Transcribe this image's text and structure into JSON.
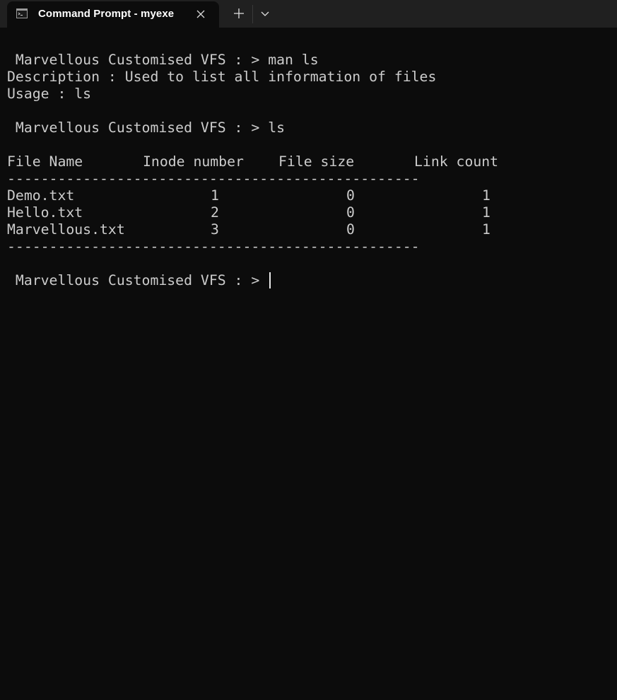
{
  "window": {
    "tab_title": "Command Prompt - myexe",
    "icons": {
      "tab_icon": "console-app-icon",
      "close": "close-icon",
      "new_tab": "plus-icon",
      "dropdown": "chevron-down-icon"
    }
  },
  "console": {
    "prompt1": " Marvellous Customised VFS : > man ls",
    "description": "Description : Used to list all information of files",
    "usage": "Usage : ls",
    "prompt2": " Marvellous Customised VFS : > ls",
    "table": {
      "headers": [
        "File Name",
        "Inode number",
        "File size",
        "Link count"
      ],
      "separator_top": "-------------------------------------------------",
      "rows": [
        [
          "Demo.txt",
          "1",
          "0",
          "1"
        ],
        [
          "Hello.txt",
          "2",
          "0",
          "1"
        ],
        [
          "Marvellous.txt",
          "3",
          "0",
          "1"
        ]
      ],
      "separator_bottom": "-------------------------------------------------"
    },
    "prompt3": " Marvellous Customised VFS : > "
  },
  "colors": {
    "background": "#0c0c0c",
    "titlebar": "#202020",
    "text": "#cccccc",
    "cursor": "#e8e8e8"
  }
}
